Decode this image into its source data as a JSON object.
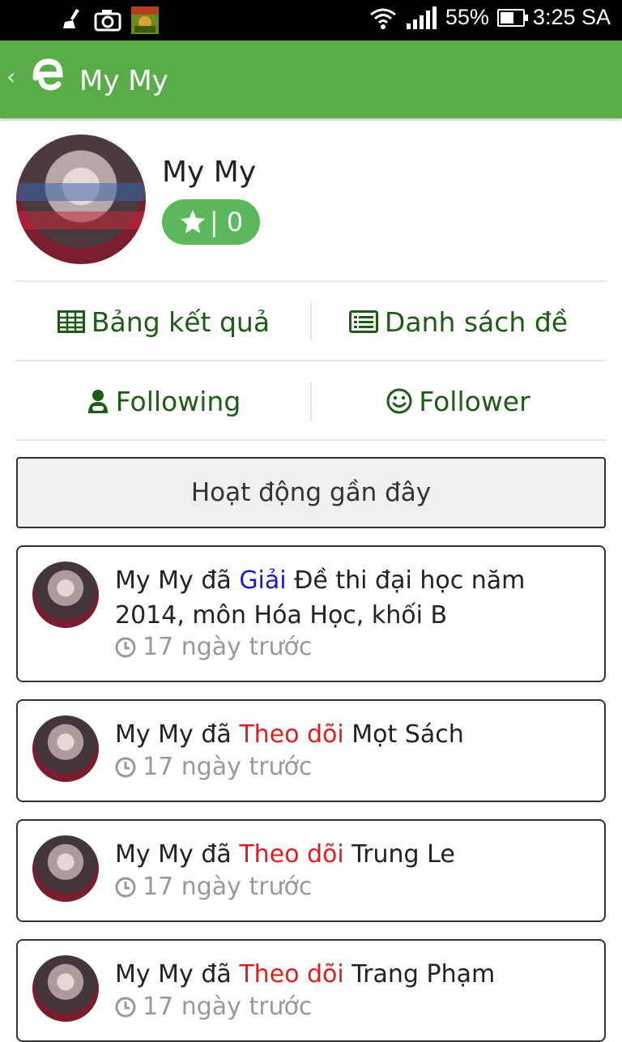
{
  "status_bar": {
    "battery": "55%",
    "battery_level": 0.55,
    "time": "3:25 SA",
    "icons": [
      "cleaner-icon",
      "camera-icon",
      "game-app-icon",
      "wifi-icon",
      "signal-icon",
      "battery-icon"
    ]
  },
  "app_bar": {
    "back": "‹",
    "title": "My My"
  },
  "profile": {
    "name": "My My",
    "rating": "| 0"
  },
  "links": {
    "results": "Bảng kết quả",
    "exam_list": "Danh sách đề",
    "following": "Following",
    "follower": "Follower"
  },
  "recent": {
    "header": "Hoạt động gần đây",
    "items": [
      {
        "actor": "My My",
        "verb_prefix": " đã ",
        "action": "Giải",
        "action_color": "#1a1ad1",
        "object": " Đề thi đại học năm 2014, môn Hóa Học, khối B",
        "time": "17 ngày trước"
      },
      {
        "actor": "My My",
        "verb_prefix": " đã ",
        "action": "Theo dõi",
        "action_color": "#e01d1d",
        "object": " Mọt Sách",
        "time": "17 ngày trước"
      },
      {
        "actor": "My My",
        "verb_prefix": " đã ",
        "action": "Theo dõi",
        "action_color": "#e01d1d",
        "object": " Trung Le",
        "time": "17 ngày trước"
      },
      {
        "actor": "My My",
        "verb_prefix": " đã ",
        "action": "Theo dõi",
        "action_color": "#e01d1d",
        "object": " Trang Phạm",
        "time": "17 ngày trước"
      }
    ]
  },
  "colors": {
    "app_bar": "#5aac4a",
    "link_text": "#1e5b17",
    "badge": "#5cb85c"
  }
}
